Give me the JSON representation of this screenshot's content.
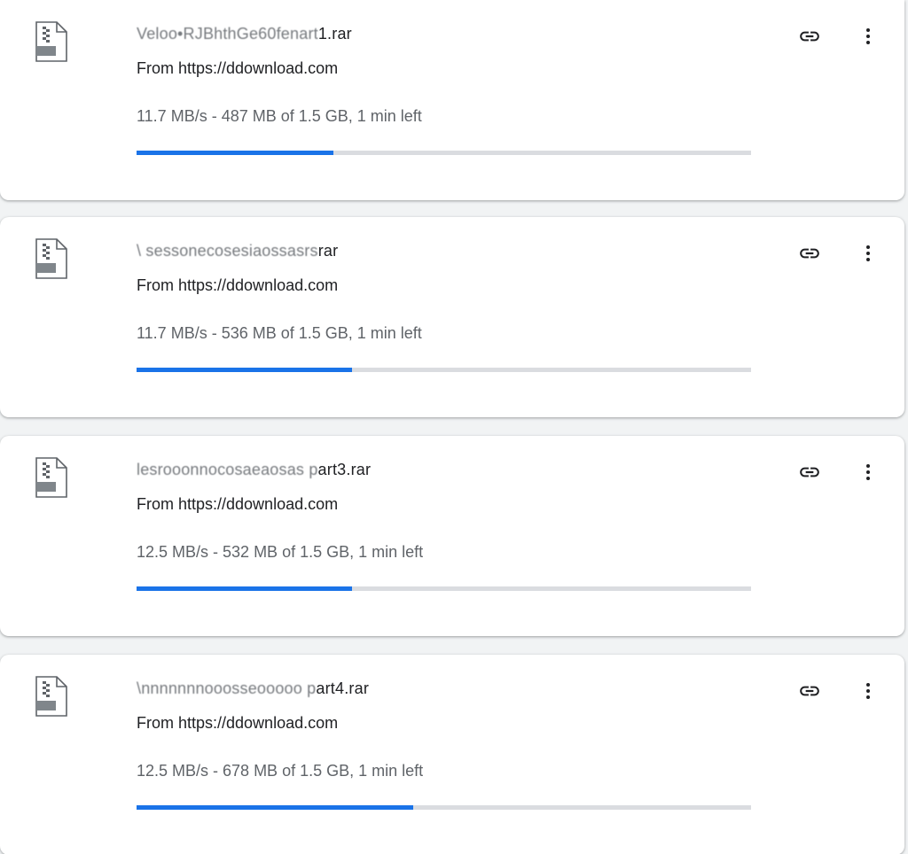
{
  "colors": {
    "accent": "#1a73e8",
    "track": "#dadce0",
    "text_primary": "#202124",
    "text_secondary": "#5f6368"
  },
  "downloads": [
    {
      "filename_obscured": "Veloo•RJBhthGe60fenart",
      "filename_visible": "1.rar",
      "source": "From https://ddownload.com",
      "status": "11.7 MB/s - 487 MB of 1.5 GB, 1 min left",
      "progress": 0.32,
      "icon": "zip-file-icon",
      "actions": [
        "link-icon",
        "more-vert-icon"
      ]
    },
    {
      "filename_obscured": "\\ sessonecosesiaossasrs",
      "filename_visible": "rar",
      "source": "From https://ddownload.com",
      "status": "11.7 MB/s - 536 MB of 1.5 GB, 1 min left",
      "progress": 0.35,
      "icon": "zip-file-icon",
      "actions": [
        "link-icon",
        "more-vert-icon"
      ]
    },
    {
      "filename_obscured": "lesrooonnocosaeaosas p",
      "filename_visible": "art3.rar",
      "source": "From https://ddownload.com",
      "status": "12.5 MB/s - 532 MB of 1.5 GB, 1 min left",
      "progress": 0.35,
      "icon": "zip-file-icon",
      "actions": [
        "link-icon",
        "more-vert-icon"
      ]
    },
    {
      "filename_obscured": "\\nnnnnnnooosseooooo p",
      "filename_visible": "art4.rar",
      "source": "From https://ddownload.com",
      "status": "12.5 MB/s - 678 MB of 1.5 GB, 1 min left",
      "progress": 0.45,
      "icon": "zip-file-icon",
      "actions": [
        "link-icon",
        "more-vert-icon"
      ]
    }
  ]
}
